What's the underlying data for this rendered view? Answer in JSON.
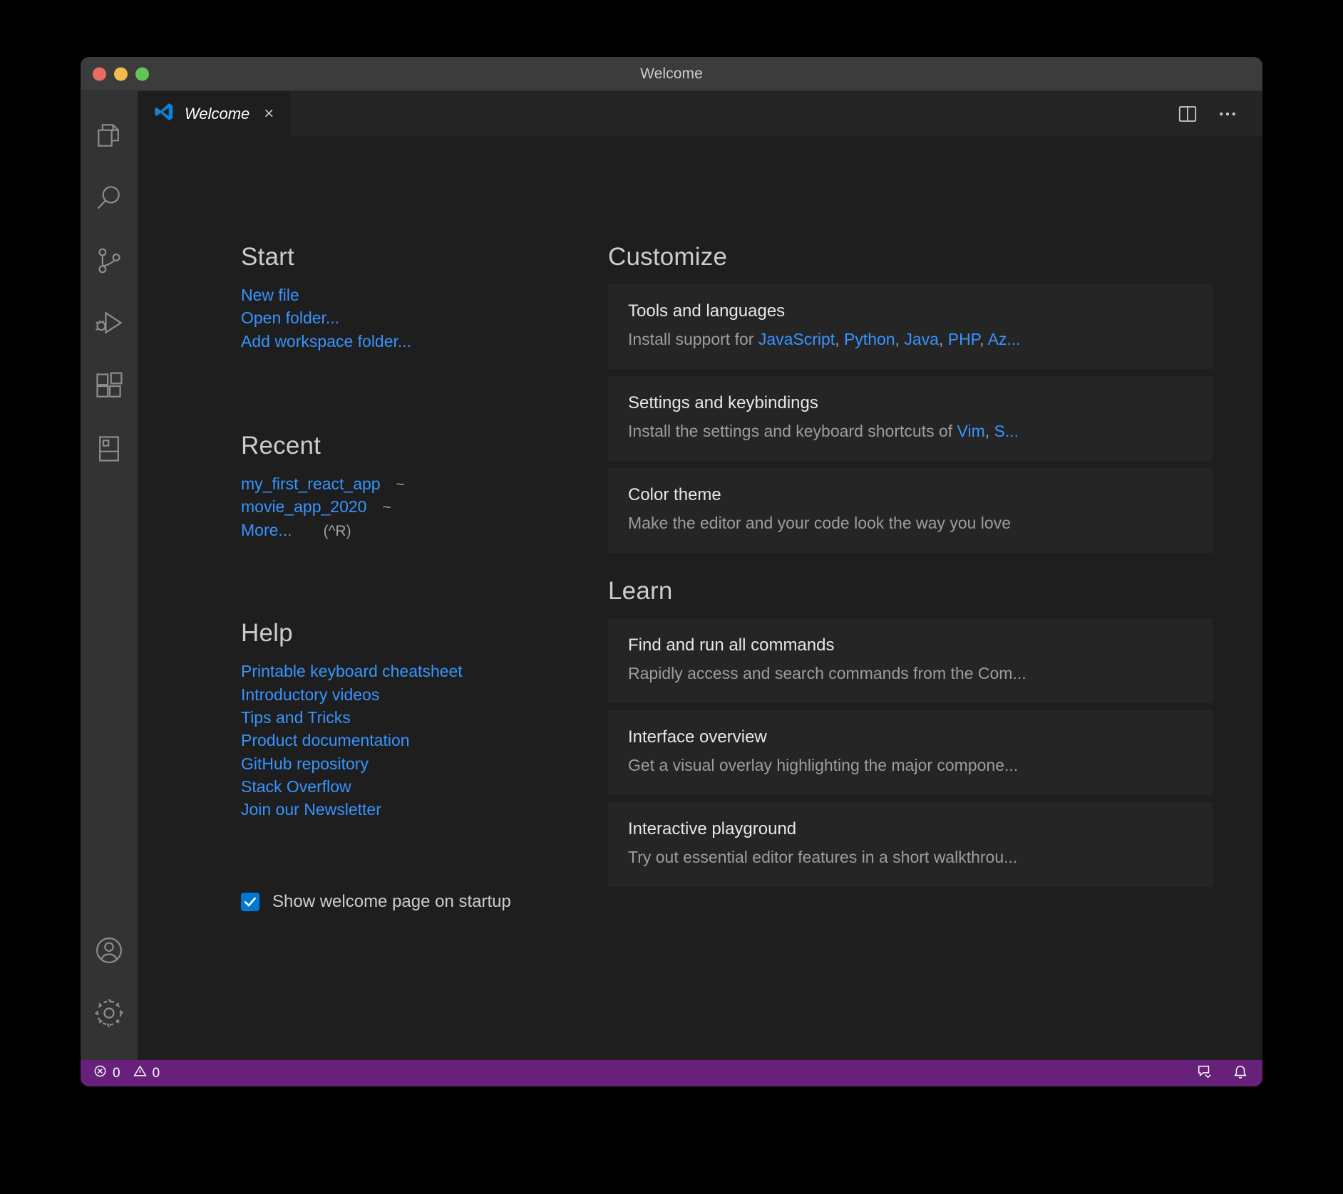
{
  "window": {
    "title": "Welcome",
    "traffic_lights": [
      "close-red",
      "minimize-yellow",
      "maximize-green"
    ]
  },
  "tab": {
    "label": "Welcome",
    "close_icon": "×",
    "actions": [
      "split-editor-icon",
      "more-actions-icon"
    ]
  },
  "activity_bar": {
    "items": [
      {
        "name": "explorer",
        "icon": "files-icon"
      },
      {
        "name": "search",
        "icon": "search-icon"
      },
      {
        "name": "source-control",
        "icon": "source-control-icon"
      },
      {
        "name": "run-and-debug",
        "icon": "run-debug-icon"
      },
      {
        "name": "extensions",
        "icon": "extensions-icon"
      },
      {
        "name": "remote-explorer",
        "icon": "remote-explorer-icon"
      }
    ],
    "bottom_items": [
      {
        "name": "accounts",
        "icon": "account-icon"
      },
      {
        "name": "manage",
        "icon": "gear-icon"
      }
    ]
  },
  "start": {
    "heading": "Start",
    "links": [
      "New file",
      "Open folder...",
      "Add workspace folder..."
    ]
  },
  "recent": {
    "heading": "Recent",
    "items": [
      {
        "name": "my_first_react_app",
        "path": "~"
      },
      {
        "name": "movie_app_2020",
        "path": "~"
      }
    ],
    "more_label": "More...",
    "more_keybinding": "(^R)"
  },
  "help": {
    "heading": "Help",
    "links": [
      "Printable keyboard cheatsheet",
      "Introductory videos",
      "Tips and Tricks",
      "Product documentation",
      "GitHub repository",
      "Stack Overflow",
      "Join our Newsletter"
    ]
  },
  "startup": {
    "checked": true,
    "label": "Show welcome page on startup"
  },
  "customize": {
    "heading": "Customize",
    "cards": [
      {
        "title": "Tools and languages",
        "desc_prefix": "Install support for ",
        "links": [
          "JavaScript",
          "Python",
          "Java",
          "PHP",
          "Az..."
        ]
      },
      {
        "title": "Settings and keybindings",
        "desc_prefix": "Install the settings and keyboard shortcuts of ",
        "links": [
          "Vim",
          "S..."
        ]
      },
      {
        "title": "Color theme",
        "desc": "Make the editor and your code look the way you love"
      }
    ]
  },
  "learn": {
    "heading": "Learn",
    "cards": [
      {
        "title": "Find and run all commands",
        "desc": "Rapidly access and search commands from the Com..."
      },
      {
        "title": "Interface overview",
        "desc": "Get a visual overlay highlighting the major compone..."
      },
      {
        "title": "Interactive playground",
        "desc": "Try out essential editor features in a short walkthrou..."
      }
    ]
  },
  "statusbar": {
    "errors": "0",
    "warnings": "0",
    "error_icon": "error-circle-icon",
    "warning_icon": "warning-triangle-icon",
    "right_icons": [
      "feedback-icon",
      "bell-icon"
    ],
    "background": "#68217a"
  },
  "colors": {
    "link": "#3794ff",
    "accent_checkbox": "#0078d4",
    "editor_bg": "#1e1e1e",
    "card_bg": "#252526",
    "activitybar_bg": "#333333",
    "titlebar_bg": "#3c3c3c"
  }
}
